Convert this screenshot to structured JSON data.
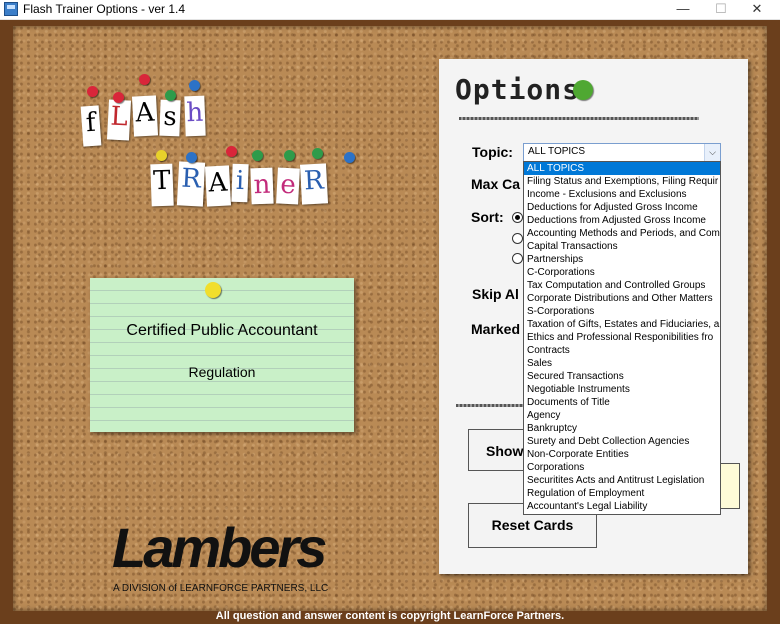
{
  "window": {
    "title": "Flash Trainer Options - ver 1.4",
    "min_glyph": "—",
    "max_glyph": "☐",
    "close_glyph": "✕"
  },
  "logo": {
    "row1": [
      "f",
      "L",
      "A",
      "s",
      "h"
    ],
    "row2": [
      "T",
      "R",
      "A",
      "i",
      "n",
      "e",
      "R"
    ]
  },
  "card": {
    "title": "Certified Public Accountant",
    "subtitle": "Regulation"
  },
  "brand": {
    "name": "Lambers",
    "tagline": "A DIVISION of LEARNFORCE PARTNERS, LLC"
  },
  "options": {
    "title": "Options",
    "topic_label": "Topic:",
    "max_label": "Max Ca",
    "sort_label": "Sort:",
    "skip_label": "Skip Al",
    "marked_label": "Marked",
    "show_label": "Show",
    "reset_label": "Reset Cards",
    "topic_value": "ALL TOPICS"
  },
  "topics": [
    "ALL TOPICS",
    "Filing Status and Exemptions, Filing Requir",
    "Income - Exclusions and Exclusions",
    "Deductions for Adjusted Gross Income",
    "Deductions from Adjusted Gross Income",
    "Accounting Methods and Periods, and Com",
    "Capital Transactions",
    "Partnerships",
    "C-Corporations",
    "Tax Computation and Controlled Groups",
    "Corporate Distributions and Other Matters",
    "S-Corporations",
    "Taxation of Gifts, Estates and Fiduciaries, a",
    "Ethics and Professional Responibilities fro",
    "Contracts",
    "Sales",
    "Secured Transactions",
    "Negotiable Instruments",
    "Documents of Title",
    "Agency",
    "Bankruptcy",
    "Surety and Debt Collection Agencies",
    "Non-Corporate Entities",
    "Corporations",
    "Securitites Acts and Antitrust Legislation",
    "Regulation of Employment",
    "Accountant's Legal Liability"
  ],
  "footer": "All question and answer content is copyright LearnForce Partners.",
  "colors": {
    "cork": "#b98a55",
    "card_green": "#c9f0c8",
    "selection": "#0078d7"
  }
}
